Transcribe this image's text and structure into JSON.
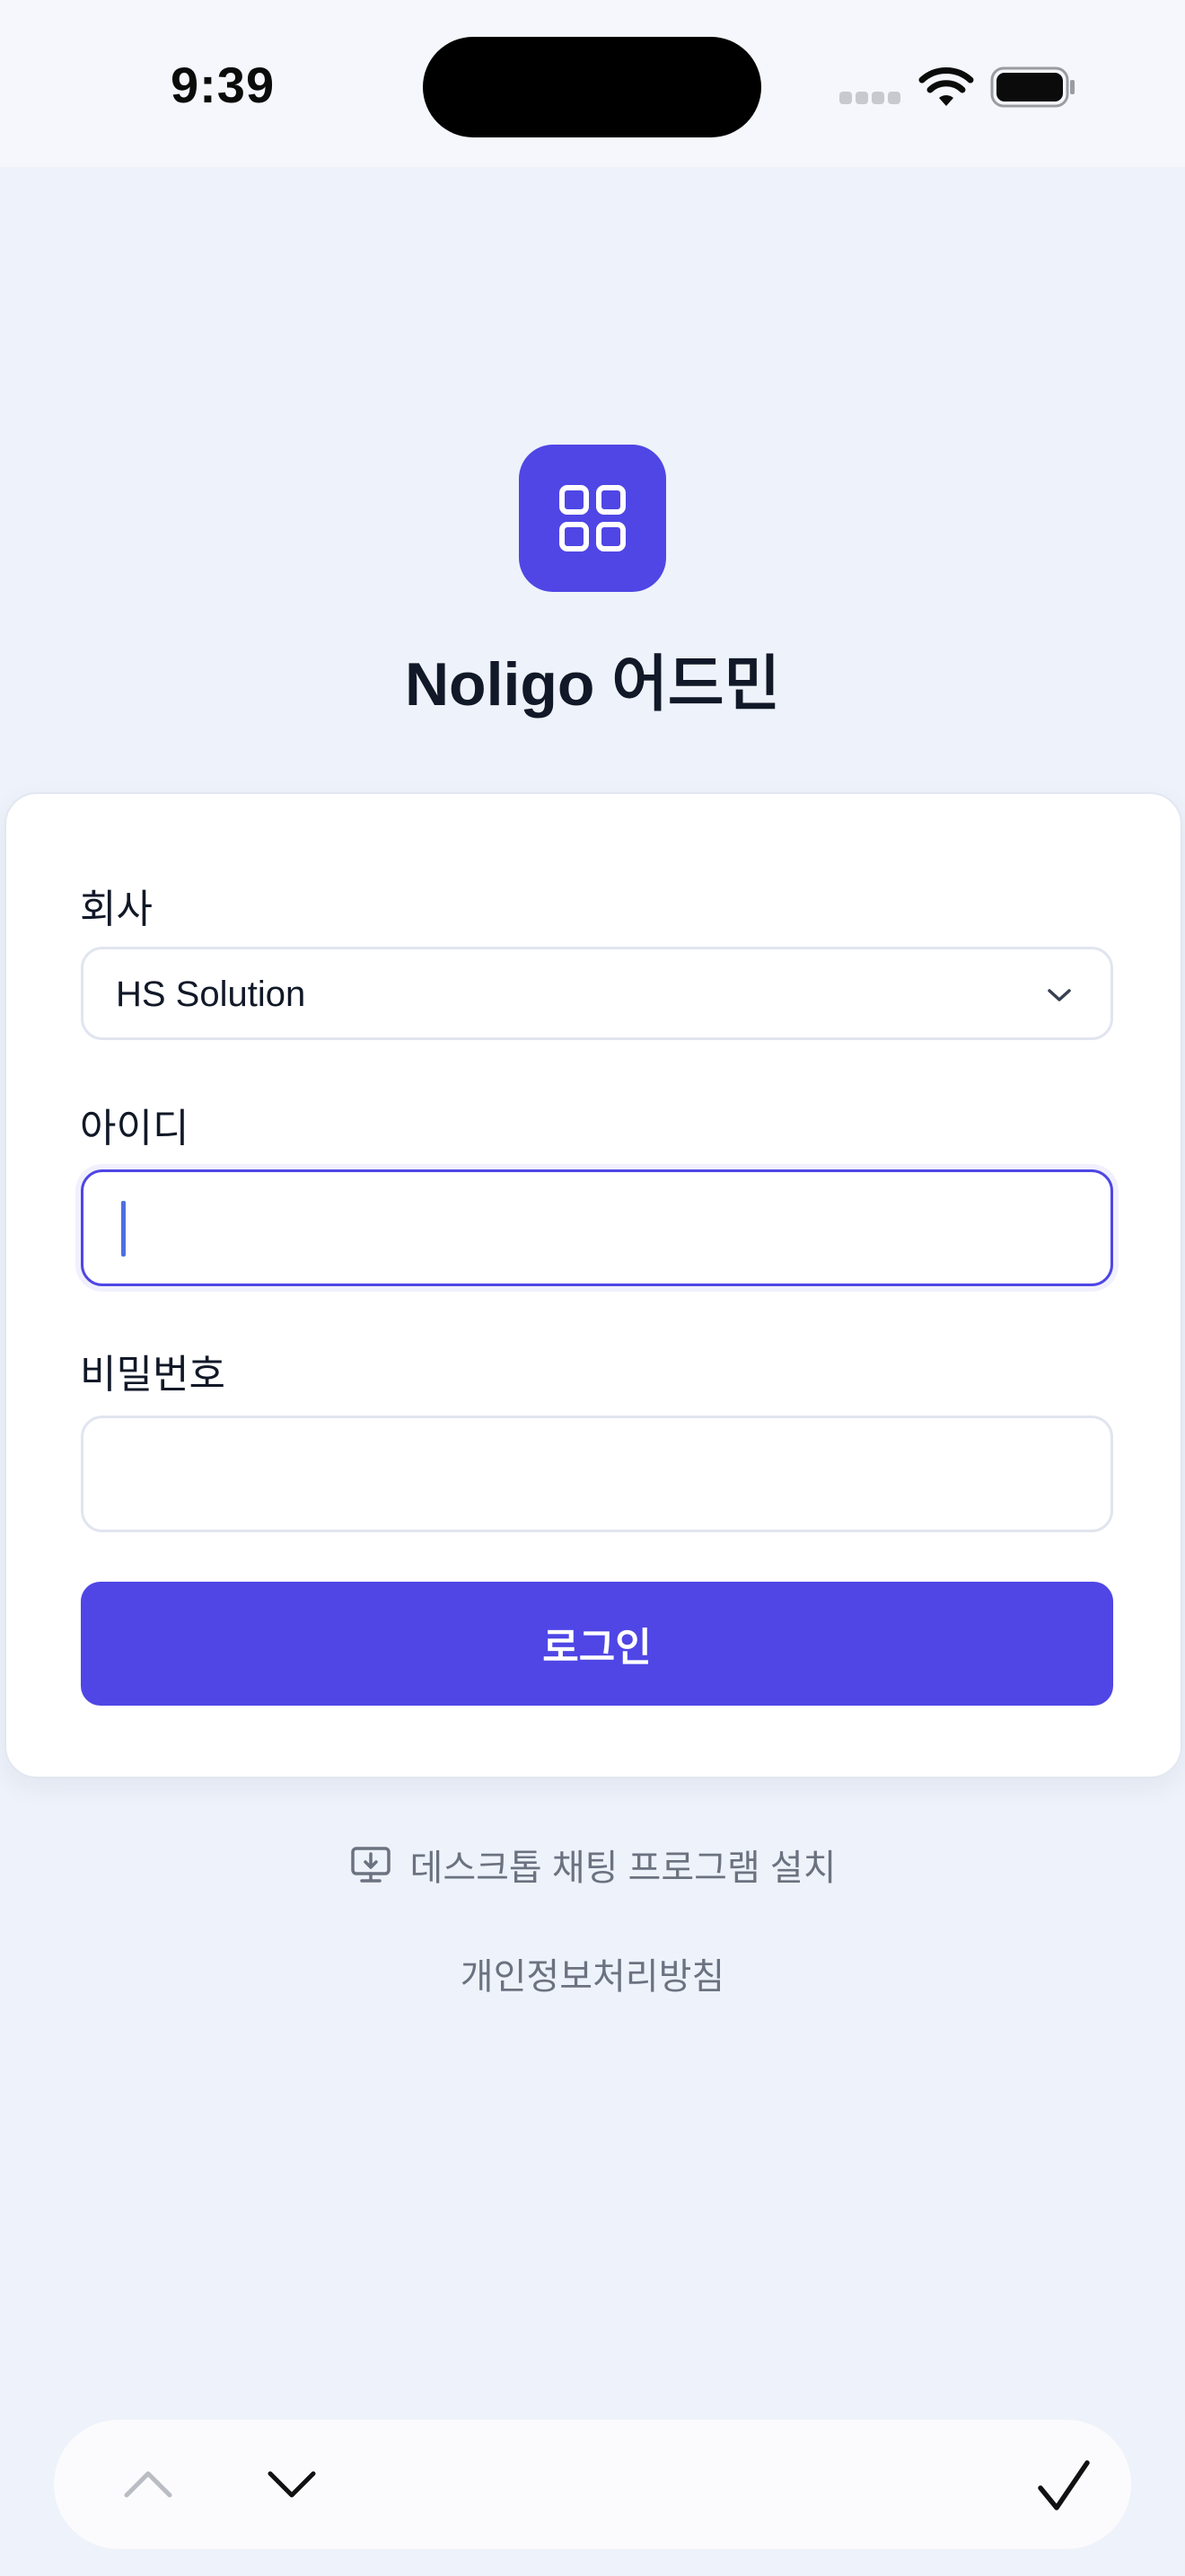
{
  "status_bar": {
    "time": "9:39"
  },
  "app": {
    "title": "Noligo 어드민"
  },
  "form": {
    "company_label": "회사",
    "company_value": "HS Solution",
    "id_label": "아이디",
    "id_value": "",
    "password_label": "비밀번호",
    "password_value": "",
    "login_button": "로그인"
  },
  "links": {
    "install": "데스크톱 채팅 프로그램 설치",
    "privacy": "개인정보처리방침"
  },
  "icons": {
    "app": "grid-icon",
    "select": "chevron-down-icon",
    "install": "monitor-download-icon",
    "keyboard_up": "chevron-up-icon",
    "keyboard_down": "chevron-down-icon",
    "keyboard_done": "checkmark-icon"
  },
  "colors": {
    "accent": "#4f46e5",
    "background": "#eef2fa",
    "text_muted": "#6b7280"
  }
}
